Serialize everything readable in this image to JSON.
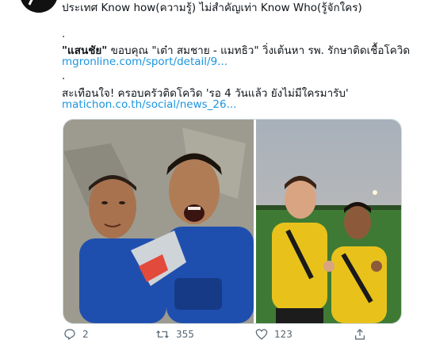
{
  "profile": {
    "header_text": "ประเทศ Know how(ความรู้) ไม่สำคัญเท่า Know Who(รู้จักใคร)"
  },
  "tweet": {
    "dot1": ".",
    "item1_prefix": "\"แสนชัย\"",
    "item1_text": " ขอบคุณ \"เต๋า สมชาย - แมทธิว\" วิ่งเต้นหา รพ. รักษาติดเชื้อโควิด",
    "item1_link": "mgronline.com/sport/detail/9...",
    "dot2": ".",
    "item2_text": "สะเทือนใจ! ครอบครัวติดโควิด 'รอ 4 วันแล้ว ยังไม่มีใครมารับ'",
    "item2_link": "matichon.co.th/social/news_26..."
  },
  "actions": {
    "reply_count": "2",
    "retweet_count": "355",
    "like_count": "123",
    "share_label": ""
  },
  "colors": {
    "link": "#1b95e0",
    "muted": "#536471",
    "blue_jersey": "#1f4fae",
    "yellow_jersey": "#e8c21b"
  }
}
